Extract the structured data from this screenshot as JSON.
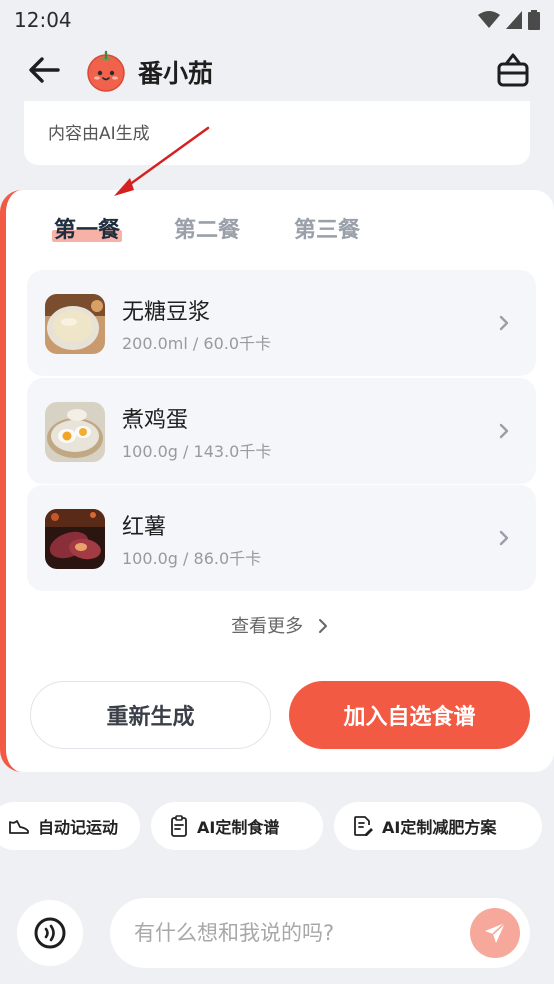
{
  "status_bar": {
    "time": "12:04"
  },
  "header": {
    "title": "番小茄",
    "back_icon": "back-arrow-icon",
    "cart_icon": "basket-icon"
  },
  "ai_card": {
    "note": "内容由AI生成"
  },
  "meal_tabs": [
    {
      "label": "第一餐",
      "active": true
    },
    {
      "label": "第二餐",
      "active": false
    },
    {
      "label": "第三餐",
      "active": false
    }
  ],
  "foods": [
    {
      "name": "无糖豆浆",
      "detail": "200.0ml / 60.0千卡",
      "image": "soy-milk"
    },
    {
      "name": "煮鸡蛋",
      "detail": "100.0g / 143.0千卡",
      "image": "boiled-egg"
    },
    {
      "name": "红薯",
      "detail": "100.0g / 86.0千卡",
      "image": "sweet-potato"
    }
  ],
  "more_label": "查看更多",
  "buttons": {
    "regenerate": "重新生成",
    "add_to_recipes": "加入自选食谱"
  },
  "chips": [
    {
      "label": "自动记运动",
      "icon": "shoe-icon"
    },
    {
      "label": "AI定制食谱",
      "icon": "clipboard-icon"
    },
    {
      "label": "AI定制减肥方案",
      "icon": "document-edit-icon"
    }
  ],
  "input": {
    "placeholder": "有什么想和我说的吗?"
  },
  "colors": {
    "accent": "#f25a43",
    "send_button": "#f6a89b",
    "background": "#eff0f4"
  }
}
